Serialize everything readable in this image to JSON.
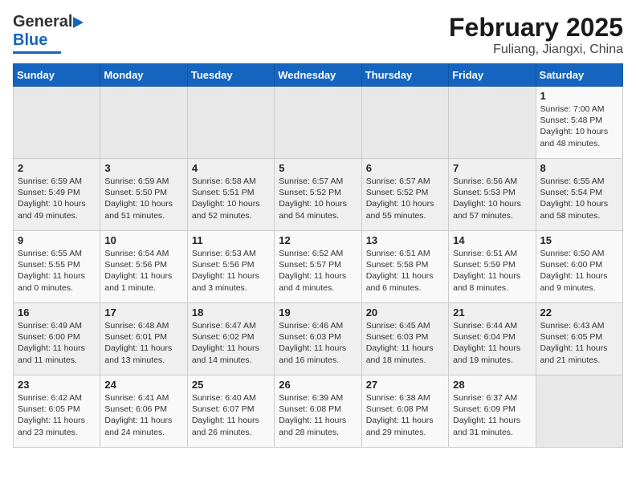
{
  "header": {
    "logo_general": "General",
    "logo_blue": "Blue",
    "main_title": "February 2025",
    "sub_title": "Fuliang, Jiangxi, China"
  },
  "weekdays": [
    "Sunday",
    "Monday",
    "Tuesday",
    "Wednesday",
    "Thursday",
    "Friday",
    "Saturday"
  ],
  "weeks": [
    [
      {
        "day": "",
        "info": ""
      },
      {
        "day": "",
        "info": ""
      },
      {
        "day": "",
        "info": ""
      },
      {
        "day": "",
        "info": ""
      },
      {
        "day": "",
        "info": ""
      },
      {
        "day": "",
        "info": ""
      },
      {
        "day": "1",
        "info": "Sunrise: 7:00 AM\nSunset: 5:48 PM\nDaylight: 10 hours\nand 48 minutes."
      }
    ],
    [
      {
        "day": "2",
        "info": "Sunrise: 6:59 AM\nSunset: 5:49 PM\nDaylight: 10 hours\nand 49 minutes."
      },
      {
        "day": "3",
        "info": "Sunrise: 6:59 AM\nSunset: 5:50 PM\nDaylight: 10 hours\nand 51 minutes."
      },
      {
        "day": "4",
        "info": "Sunrise: 6:58 AM\nSunset: 5:51 PM\nDaylight: 10 hours\nand 52 minutes."
      },
      {
        "day": "5",
        "info": "Sunrise: 6:57 AM\nSunset: 5:52 PM\nDaylight: 10 hours\nand 54 minutes."
      },
      {
        "day": "6",
        "info": "Sunrise: 6:57 AM\nSunset: 5:52 PM\nDaylight: 10 hours\nand 55 minutes."
      },
      {
        "day": "7",
        "info": "Sunrise: 6:56 AM\nSunset: 5:53 PM\nDaylight: 10 hours\nand 57 minutes."
      },
      {
        "day": "8",
        "info": "Sunrise: 6:55 AM\nSunset: 5:54 PM\nDaylight: 10 hours\nand 58 minutes."
      }
    ],
    [
      {
        "day": "9",
        "info": "Sunrise: 6:55 AM\nSunset: 5:55 PM\nDaylight: 11 hours\nand 0 minutes."
      },
      {
        "day": "10",
        "info": "Sunrise: 6:54 AM\nSunset: 5:56 PM\nDaylight: 11 hours\nand 1 minute."
      },
      {
        "day": "11",
        "info": "Sunrise: 6:53 AM\nSunset: 5:56 PM\nDaylight: 11 hours\nand 3 minutes."
      },
      {
        "day": "12",
        "info": "Sunrise: 6:52 AM\nSunset: 5:57 PM\nDaylight: 11 hours\nand 4 minutes."
      },
      {
        "day": "13",
        "info": "Sunrise: 6:51 AM\nSunset: 5:58 PM\nDaylight: 11 hours\nand 6 minutes."
      },
      {
        "day": "14",
        "info": "Sunrise: 6:51 AM\nSunset: 5:59 PM\nDaylight: 11 hours\nand 8 minutes."
      },
      {
        "day": "15",
        "info": "Sunrise: 6:50 AM\nSunset: 6:00 PM\nDaylight: 11 hours\nand 9 minutes."
      }
    ],
    [
      {
        "day": "16",
        "info": "Sunrise: 6:49 AM\nSunset: 6:00 PM\nDaylight: 11 hours\nand 11 minutes."
      },
      {
        "day": "17",
        "info": "Sunrise: 6:48 AM\nSunset: 6:01 PM\nDaylight: 11 hours\nand 13 minutes."
      },
      {
        "day": "18",
        "info": "Sunrise: 6:47 AM\nSunset: 6:02 PM\nDaylight: 11 hours\nand 14 minutes."
      },
      {
        "day": "19",
        "info": "Sunrise: 6:46 AM\nSunset: 6:03 PM\nDaylight: 11 hours\nand 16 minutes."
      },
      {
        "day": "20",
        "info": "Sunrise: 6:45 AM\nSunset: 6:03 PM\nDaylight: 11 hours\nand 18 minutes."
      },
      {
        "day": "21",
        "info": "Sunrise: 6:44 AM\nSunset: 6:04 PM\nDaylight: 11 hours\nand 19 minutes."
      },
      {
        "day": "22",
        "info": "Sunrise: 6:43 AM\nSunset: 6:05 PM\nDaylight: 11 hours\nand 21 minutes."
      }
    ],
    [
      {
        "day": "23",
        "info": "Sunrise: 6:42 AM\nSunset: 6:05 PM\nDaylight: 11 hours\nand 23 minutes."
      },
      {
        "day": "24",
        "info": "Sunrise: 6:41 AM\nSunset: 6:06 PM\nDaylight: 11 hours\nand 24 minutes."
      },
      {
        "day": "25",
        "info": "Sunrise: 6:40 AM\nSunset: 6:07 PM\nDaylight: 11 hours\nand 26 minutes."
      },
      {
        "day": "26",
        "info": "Sunrise: 6:39 AM\nSunset: 6:08 PM\nDaylight: 11 hours\nand 28 minutes."
      },
      {
        "day": "27",
        "info": "Sunrise: 6:38 AM\nSunset: 6:08 PM\nDaylight: 11 hours\nand 29 minutes."
      },
      {
        "day": "28",
        "info": "Sunrise: 6:37 AM\nSunset: 6:09 PM\nDaylight: 11 hours\nand 31 minutes."
      },
      {
        "day": "",
        "info": ""
      }
    ]
  ]
}
